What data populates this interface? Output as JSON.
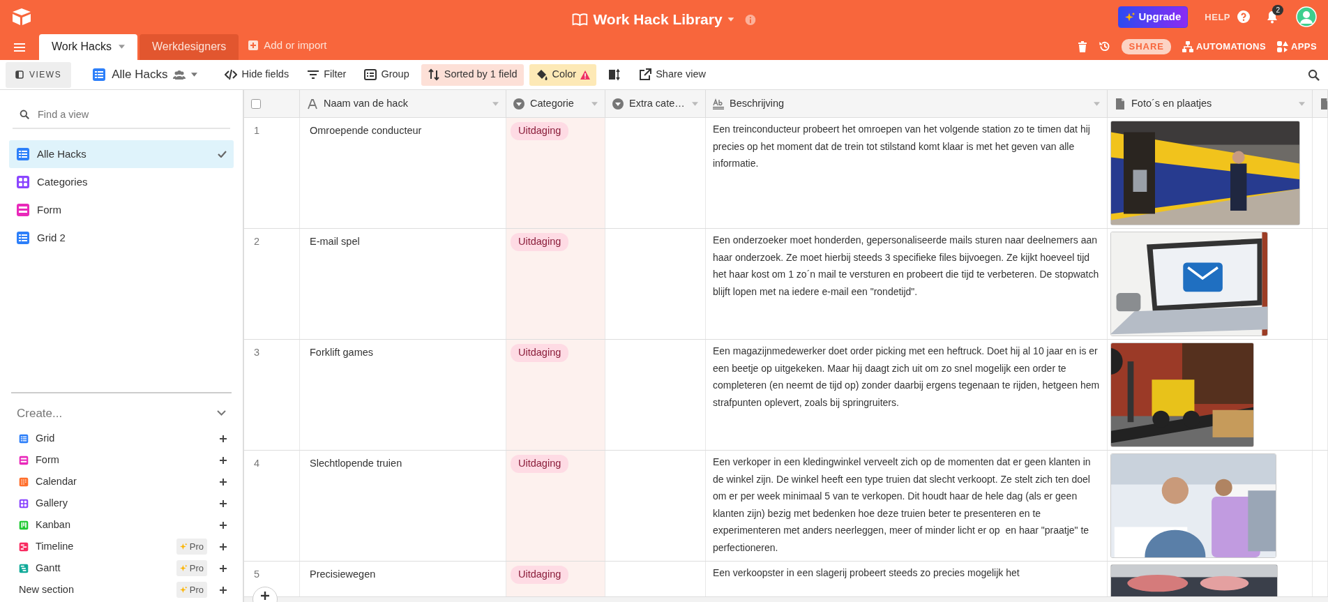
{
  "app_bar": {
    "title": "Work Hack Library",
    "upgrade": "Upgrade",
    "help": "HELP",
    "notifications": "2"
  },
  "tables": [
    {
      "label": "Work Hacks",
      "selected": true
    },
    {
      "label": "Werkdesigners",
      "selected": false
    }
  ],
  "add_table": "Add or import",
  "base_actions": {
    "share": "SHARE",
    "automations": "AUTOMATIONS",
    "apps": "APPS"
  },
  "view_bar": {
    "views_button": "VIEWS",
    "current_view": "Alle Hacks",
    "tools": [
      {
        "kind": "hide",
        "label": "Hide fields",
        "active": false
      },
      {
        "kind": "filter",
        "label": "Filter",
        "active": false
      },
      {
        "kind": "group",
        "label": "Group",
        "active": false
      },
      {
        "kind": "sort",
        "label": "Sorted by 1 field",
        "active": true
      },
      {
        "kind": "color",
        "label": "Color",
        "active": true
      },
      {
        "kind": "row_height",
        "active": false
      },
      {
        "kind": "share",
        "label": "Share view",
        "active": false
      }
    ]
  },
  "sidebar": {
    "search_placeholder": "Find a view",
    "views": [
      {
        "label": "Alle Hacks",
        "kind": "grid",
        "selected": true
      },
      {
        "label": "Categories",
        "kind": "gallery",
        "selected": false
      },
      {
        "label": "Form",
        "kind": "form",
        "selected": false
      },
      {
        "label": "Grid 2",
        "kind": "grid",
        "selected": false
      }
    ],
    "create_title": "Create...",
    "create_items": [
      {
        "label": "Grid",
        "kind": "grid"
      },
      {
        "label": "Form",
        "kind": "form"
      },
      {
        "label": "Calendar",
        "kind": "calendar"
      },
      {
        "label": "Gallery",
        "kind": "gallery"
      },
      {
        "label": "Kanban",
        "kind": "kanban"
      },
      {
        "label": "Timeline",
        "kind": "timeline",
        "badge": "Pro"
      },
      {
        "label": "Gantt",
        "kind": "gantt",
        "badge": "Pro"
      },
      {
        "label": "New section",
        "kind": "section",
        "badge": "Pro"
      }
    ]
  },
  "table": {
    "select_all": {
      "checked": false
    },
    "columns": [
      {
        "label": "Naam van de hack",
        "kind": "text",
        "sorted": false
      },
      {
        "label": "Categorie",
        "kind": "select",
        "sorted": true
      },
      {
        "label": "Extra cate…",
        "kind": "select",
        "sorted": false
      },
      {
        "label": "Beschrijving",
        "kind": "longtext",
        "sorted": false
      },
      {
        "label": "Foto´s en plaatjes",
        "kind": "attachment",
        "sorted": false
      },
      {
        "kind": "attachment",
        "sorted": false
      }
    ],
    "rows": [
      {
        "number": "1",
        "name": "Omroepende conducteur",
        "category": "Uitdaging",
        "description": "Een treinconducteur probeert het omroepen van het volgende station zo te timen dat hij precies op het moment dat de trein tot stilstand komt klaar is met het geven van alle informatie."
      },
      {
        "number": "2",
        "name": "E-mail spel",
        "category": "Uitdaging",
        "description": "Een onderzoeker moet honderden, gepersonaliseerde mails sturen naar deelnemers aan haar onderzoek. Ze moet hierbij steeds 3 specifieke files bijvoegen. Ze kijkt hoeveel tijd het haar kost om 1 zo´n mail te versturen en probeert die tijd te verbeteren. De stopwatch blijft lopen met na iedere e-mail een \"rondetijd\"."
      },
      {
        "number": "3",
        "name": "Forklift games",
        "category": "Uitdaging",
        "description": "Een magazijnmedewerker doet order picking met een heftruck. Doet hij al 10 jaar en is er een beetje op uitgekeken. Maar hij daagt zich uit om zo snel mogelijk een order te completeren (en neemt de tijd op) zonder daarbij ergens tegenaan te rijden, hetgeen hem strafpunten oplevert, zoals bij springruiters."
      },
      {
        "number": "4",
        "name": "Slechtlopende truien",
        "category": "Uitdaging",
        "description": "Een verkoper in een kledingwinkel verveelt zich op de momenten dat er geen klanten in de winkel zijn. De winkel heeft een type truien dat slecht verkoopt. Ze stelt zich ten doel om er per week minimaal 5 van te verkopen. Dit houdt haar de hele dag (als er geen klanten zijn) bezig met bedenken hoe deze truien beter te presenteren en te experimenteren met anders neerleggen, meer of minder licht er op  en haar \"praatje\" te perfectioneren."
      },
      {
        "number": "5",
        "name": "Precisiewegen",
        "category": "Uitdaging",
        "description": "Een verkoopster in een slagerij probeert steeds zo precies mogelijk het"
      }
    ]
  }
}
